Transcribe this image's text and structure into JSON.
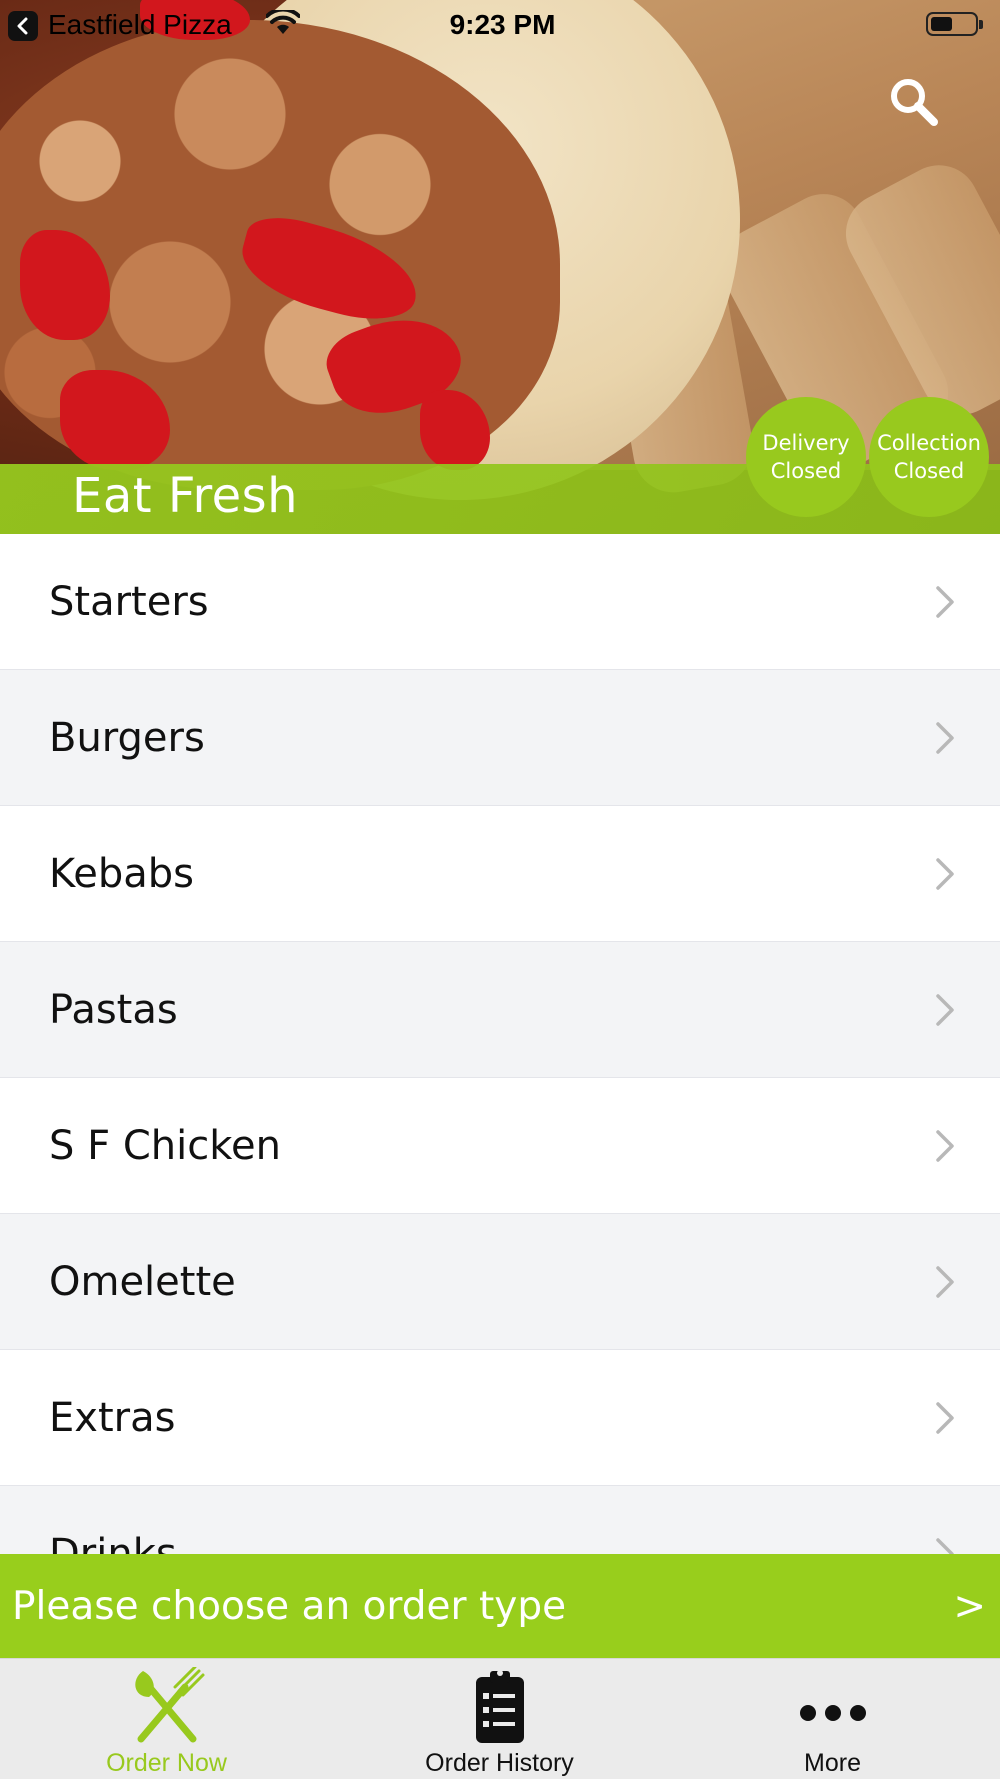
{
  "status_bar": {
    "back_app": "Eastfield Pizza",
    "time": "9:23 PM",
    "battery_level": 0.5
  },
  "hero": {
    "title": "Eat Fresh",
    "delivery": {
      "line1": "Delivery",
      "line2": "Closed"
    },
    "collection": {
      "line1": "Collection",
      "line2": "Closed"
    }
  },
  "menu": {
    "items": [
      {
        "label": "Starters"
      },
      {
        "label": "Burgers"
      },
      {
        "label": "Kebabs"
      },
      {
        "label": "Pastas"
      },
      {
        "label": "S F Chicken"
      },
      {
        "label": "Omelette"
      },
      {
        "label": "Extras"
      },
      {
        "label": "Drinks"
      }
    ]
  },
  "order_bar": {
    "text": "Please choose an order type",
    "arrow": ">"
  },
  "tabs": [
    {
      "label": "Order Now",
      "icon": "fork-knife-icon",
      "active": true
    },
    {
      "label": "Order History",
      "icon": "clipboard-list-icon",
      "active": false
    },
    {
      "label": "More",
      "icon": "more-dots-icon",
      "active": false
    }
  ],
  "colors": {
    "accent_green": "#98ce1c",
    "active_tab": "#98c91e",
    "inactive_tab": "#111111",
    "row_alt": "#f3f4f6"
  }
}
